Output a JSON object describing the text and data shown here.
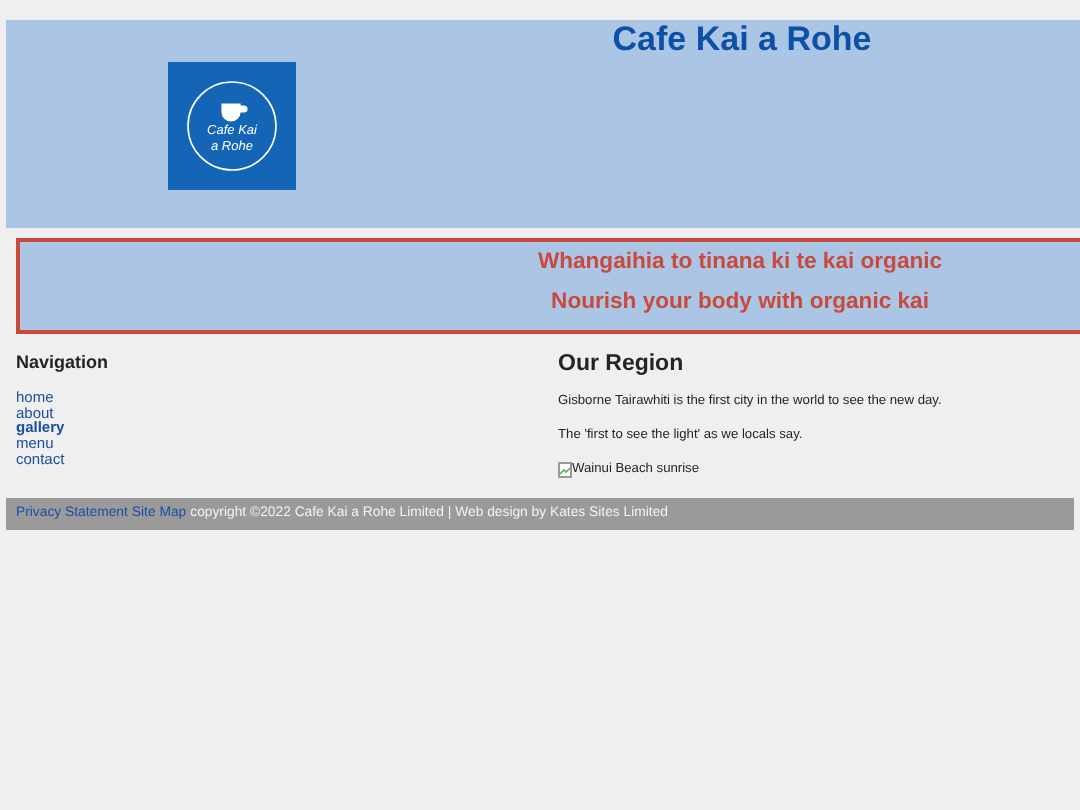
{
  "header": {
    "title": "Cafe Kai a Rohe",
    "logo_text": [
      "Cafe Kai",
      "a Rohe"
    ]
  },
  "banner": {
    "lines": [
      "Whangaihia to tinana ki te kai organic",
      "Nourish your body with organic kai"
    ]
  },
  "navigation": {
    "heading": "Navigation",
    "items": [
      {
        "label": "home",
        "selected": false
      },
      {
        "label": "about",
        "selected": false
      },
      {
        "label": "gallery",
        "selected": true
      },
      {
        "label": "menu",
        "selected": false
      },
      {
        "label": "contact",
        "selected": false
      }
    ]
  },
  "region": {
    "heading": "Our Region",
    "paragraphs": [
      "Gisborne Tairawhiti is the first city in the world to see the new day.",
      "The 'first to see the light' as we locals say."
    ],
    "image_alt": "Wainui Beach sunrise"
  },
  "footer": {
    "links": [
      "Privacy Statement",
      "Site Map"
    ],
    "text": "copyright ©2022 Cafe Kai a Rohe Limited | Web design by Kates Sites Limited"
  }
}
